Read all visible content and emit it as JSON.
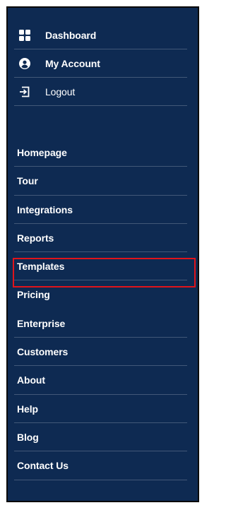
{
  "account_menu": [
    {
      "label": "Dashboard",
      "icon": "dashboard-grid-icon"
    },
    {
      "label": "My Account",
      "icon": "user-circle-icon"
    },
    {
      "label": "Logout",
      "icon": "logout-icon"
    }
  ],
  "nav_menu": [
    {
      "label": "Homepage"
    },
    {
      "label": "Tour"
    },
    {
      "label": "Integrations"
    },
    {
      "label": "Reports"
    },
    {
      "label": "Templates"
    },
    {
      "label": "Pricing",
      "highlighted": true
    },
    {
      "label": "Enterprise"
    },
    {
      "label": "Customers"
    },
    {
      "label": "About"
    },
    {
      "label": "Help"
    },
    {
      "label": "Blog"
    },
    {
      "label": "Contact Us"
    }
  ],
  "colors": {
    "panel_bg": "#0e2a52",
    "text": "#ffffff",
    "highlight": "#e0141b"
  }
}
